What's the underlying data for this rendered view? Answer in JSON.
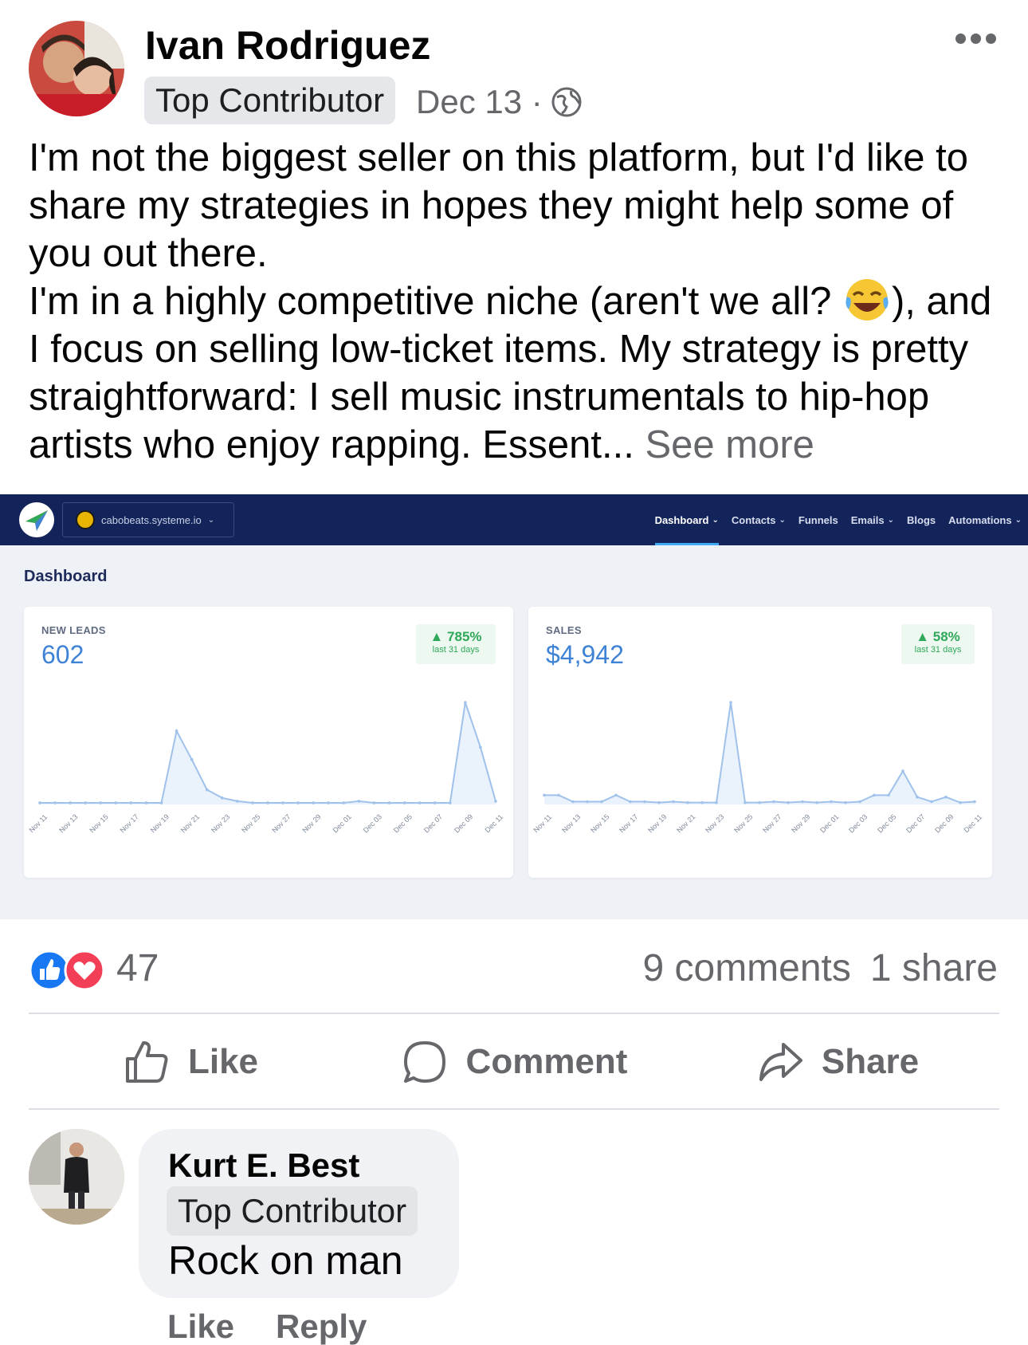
{
  "post": {
    "author": "Ivan Rodriguez",
    "badge": "Top Contributor",
    "date": "Dec 13 ·",
    "text_lines": [
      "I'm not the biggest seller on this platform, but I'd like to share my strategies in hopes they might help some of you out there.",
      "I'm in a highly competitive niche (aren't we all?",
      "), and I focus on selling low-ticket items. My strategy is pretty straightforward: I sell music instrumentals to hip-hop artists who enjoy rapping. Essent... "
    ],
    "see_more": "See more"
  },
  "dashboard": {
    "site": "cabobeats.systeme.io",
    "menu": [
      "Dashboard",
      "Contacts",
      "Funnels",
      "Emails",
      "Blogs",
      "Automations"
    ],
    "title": "Dashboard",
    "leads_card": {
      "label": "NEW LEADS",
      "value": "602",
      "trend": "785%",
      "trend_sub": "last 31 days"
    },
    "sales_card": {
      "label": "SALES",
      "value": "$4,942",
      "trend": "58%",
      "trend_sub": "last 31 days"
    },
    "x_ticks": [
      "Nov 11",
      "Nov 13",
      "Nov 15",
      "Nov 17",
      "Nov 19",
      "Nov 21",
      "Nov 23",
      "Nov 25",
      "Nov 27",
      "Nov 29",
      "Dec 01",
      "Dec 03",
      "Dec 05",
      "Dec 07",
      "Dec 09",
      "Dec 11"
    ]
  },
  "chart_data": [
    {
      "type": "area",
      "title": "NEW LEADS",
      "x": [
        "Nov 11",
        "Nov 12",
        "Nov 13",
        "Nov 14",
        "Nov 15",
        "Nov 16",
        "Nov 17",
        "Nov 18",
        "Nov 19",
        "Nov 20",
        "Nov 21",
        "Nov 22",
        "Nov 23",
        "Nov 24",
        "Nov 25",
        "Nov 26",
        "Nov 27",
        "Nov 28",
        "Nov 29",
        "Nov 30",
        "Dec 01",
        "Dec 02",
        "Dec 03",
        "Dec 04",
        "Dec 05",
        "Dec 06",
        "Dec 07",
        "Dec 08",
        "Dec 09",
        "Dec 10",
        "Dec 11"
      ],
      "values": [
        2,
        2,
        2,
        2,
        2,
        2,
        2,
        2,
        2,
        90,
        55,
        18,
        8,
        4,
        2,
        2,
        2,
        2,
        2,
        2,
        2,
        4,
        2,
        2,
        2,
        2,
        2,
        2,
        125,
        70,
        4
      ]
    },
    {
      "type": "area",
      "title": "SALES",
      "x": [
        "Nov 11",
        "Nov 12",
        "Nov 13",
        "Nov 14",
        "Nov 15",
        "Nov 16",
        "Nov 17",
        "Nov 18",
        "Nov 19",
        "Nov 20",
        "Nov 21",
        "Nov 22",
        "Nov 23",
        "Nov 24",
        "Nov 25",
        "Nov 26",
        "Nov 27",
        "Nov 28",
        "Nov 29",
        "Nov 30",
        "Dec 01",
        "Dec 02",
        "Dec 03",
        "Dec 04",
        "Dec 05",
        "Dec 06",
        "Dec 07",
        "Dec 08",
        "Dec 09",
        "Dec 10",
        "Dec 11"
      ],
      "values": [
        10,
        10,
        3,
        3,
        3,
        10,
        3,
        3,
        2,
        3,
        2,
        2,
        2,
        110,
        2,
        2,
        3,
        2,
        3,
        2,
        3,
        2,
        3,
        10,
        10,
        36,
        8,
        3,
        8,
        2,
        3
      ]
    }
  ],
  "reactions": {
    "count": "47",
    "comments": "9 comments",
    "shares": "1 share"
  },
  "actions": {
    "like": "Like",
    "comment": "Comment",
    "share": "Share"
  },
  "comment": {
    "author": "Kurt E. Best",
    "badge": "Top Contributor",
    "text": "Rock on man",
    "like": "Like",
    "reply": "Reply"
  },
  "colors": {
    "brand_nav": "#13245a",
    "chart_line": "#9fc1ea",
    "trend_green": "#2fa85a",
    "like_blue": "#1877f2",
    "love_red": "#f33e58"
  },
  "icons": [
    "more-icon",
    "globe-icon",
    "laughing-emoji-icon",
    "like-reaction-icon",
    "love-reaction-icon",
    "thumbs-up-icon",
    "comment-icon",
    "share-icon",
    "systeme-logo-icon"
  ]
}
